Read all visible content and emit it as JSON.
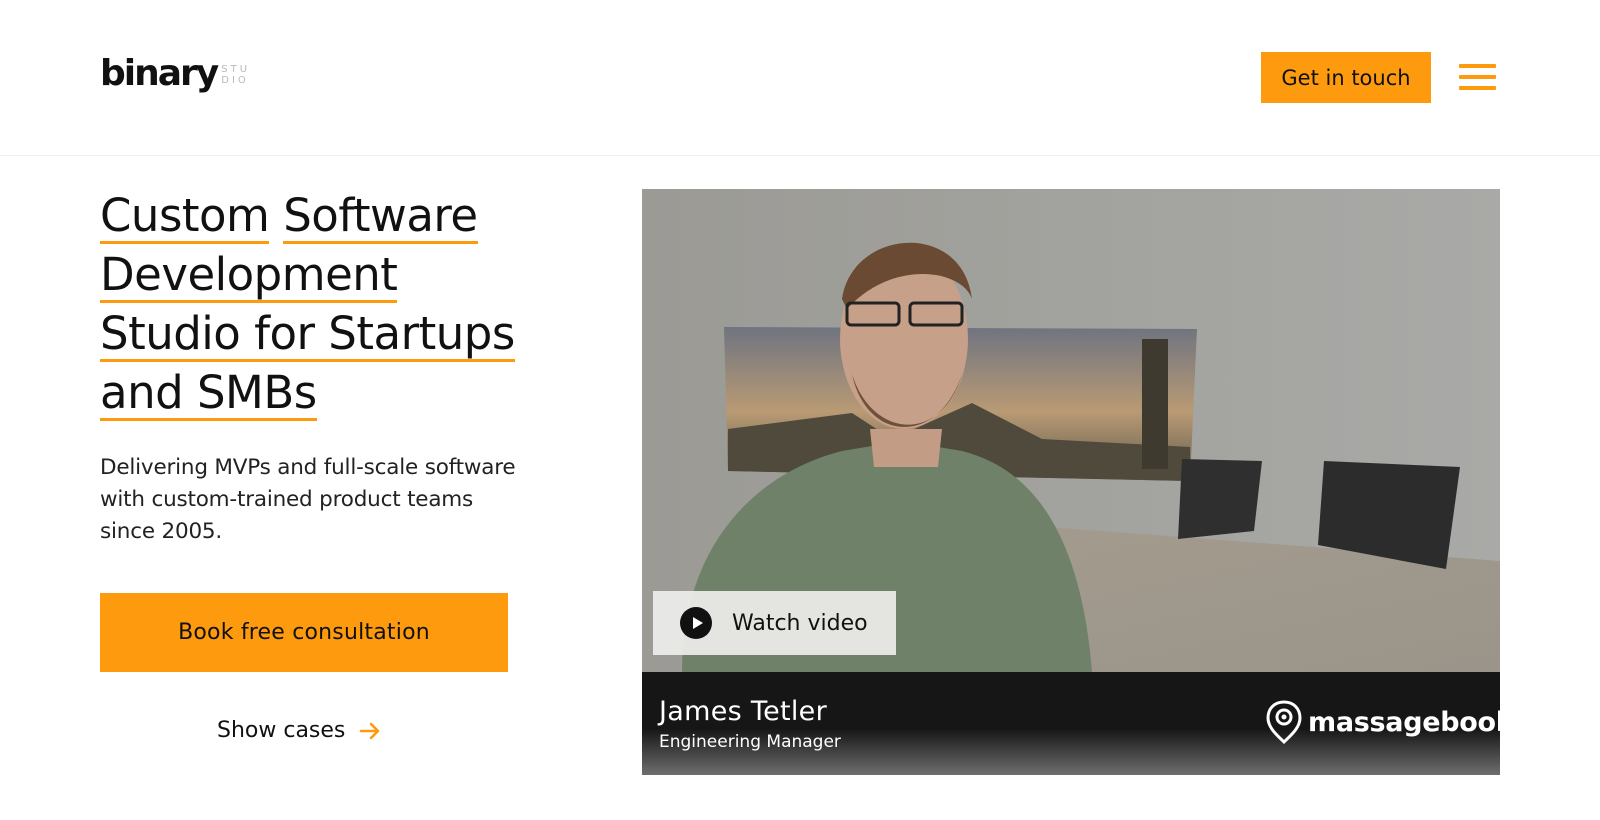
{
  "header": {
    "logo_word": "binary",
    "logo_sub_top": "STU",
    "logo_sub_bottom": "DIO",
    "cta_label": "Get in touch",
    "menu_icon": "hamburger-icon"
  },
  "hero": {
    "title_lines": [
      "Custom",
      "Software",
      "Development",
      "Studio for Startups",
      "and SMBs"
    ],
    "description": "Delivering MVPs and full-scale software with custom-trained product teams since 2005.",
    "primary_button": "Book free consultation",
    "secondary_link": "Show cases"
  },
  "video": {
    "watch_label": "Watch video",
    "person_name": "James Tetler",
    "person_role": "Engineering Manager",
    "brand": "massagebook"
  },
  "colors": {
    "accent": "#fd9a0d",
    "text": "#111111",
    "caption_bg": "#161616"
  }
}
